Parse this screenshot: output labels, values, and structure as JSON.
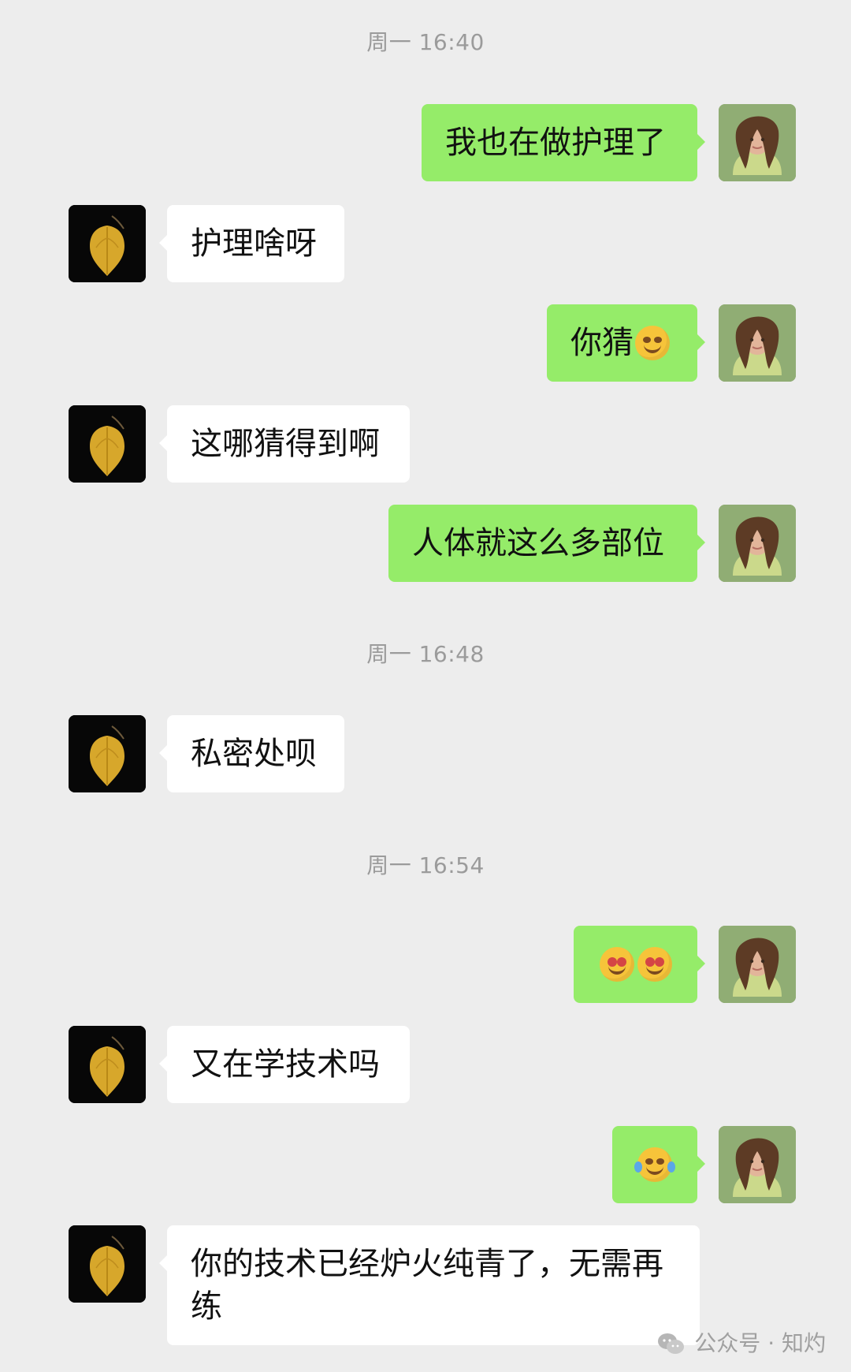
{
  "chat": {
    "timestamps": [
      "周一 16:40",
      "周一 16:48",
      "周一 16:54"
    ],
    "messages": [
      {
        "side": "right",
        "text": "我也在做护理了"
      },
      {
        "side": "left",
        "text": "护理啥呀"
      },
      {
        "side": "right",
        "text": "你猜"
      },
      {
        "side": "left",
        "text": "这哪猜得到啊"
      },
      {
        "side": "right",
        "text": "人体就这么多部位"
      },
      {
        "side": "left",
        "text": "私密处呗"
      },
      {
        "side": "right",
        "text": ""
      },
      {
        "side": "left",
        "text": "又在学技术吗"
      },
      {
        "side": "right",
        "text": ""
      },
      {
        "side": "left",
        "text": "你的技术已经炉火纯青了，无需再练"
      }
    ]
  },
  "watermark": {
    "text": "公众号 · 知灼"
  },
  "icons": {
    "watermark_icon": "wechat-official-account-icon",
    "emoji_wink": "smirk-emoji",
    "emoji_heart_eyes": "heart-eyes-emoji",
    "emoji_laugh_tears": "laughing-tears-emoji"
  }
}
